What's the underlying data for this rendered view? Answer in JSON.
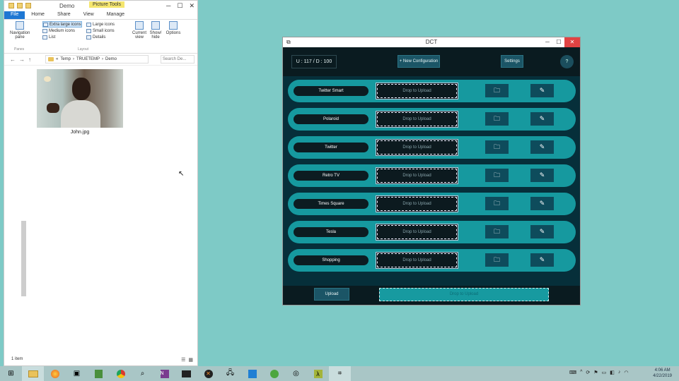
{
  "explorer": {
    "title": "Demo",
    "picture_tools": "Picture Tools",
    "tabs": [
      "File",
      "Home",
      "Share",
      "View",
      "Manage"
    ],
    "ribbon": {
      "nav_pane": "Navigation pane",
      "group_panes": "Panes",
      "layout": [
        "Extra large icons",
        "Large icons",
        "Medium icons",
        "Small icons",
        "List",
        "Details"
      ],
      "group_layout": "Layout",
      "current_view": "Current view",
      "show_hide": "Show/ hide",
      "options": "Options"
    },
    "path": [
      "«",
      "Temp",
      "›",
      "TRUETEMP",
      "›",
      "Demo"
    ],
    "search_placeholder": "Search De...",
    "file_name": "John.jpg",
    "status": "1 item"
  },
  "dct": {
    "title": "DCT",
    "ud": "U : 117 / D : 100",
    "new_config": "+ New Configuration",
    "settings": "Settings",
    "help": "?",
    "drop_label": "Drop to Upload",
    "rows": [
      {
        "name": "Twitter Smart"
      },
      {
        "name": "Polaroid"
      },
      {
        "name": "Twitter"
      },
      {
        "name": "Retro TV"
      },
      {
        "name": "Times Square"
      },
      {
        "name": "Tesla"
      },
      {
        "name": "Shopping"
      }
    ],
    "upload": "Upload",
    "bottom_drop": "Drop to Upload"
  },
  "taskbar": {
    "icons": [
      "start-icon",
      "file-explorer-icon",
      "firefox-icon",
      "app-icon",
      "sheet-icon",
      "chrome-icon",
      "search-app-icon",
      "onenote-icon",
      "terminal-icon",
      "x-app-icon",
      "network-icon",
      "vscode-icon",
      "green-app-icon",
      "disk-icon",
      "lambda-icon",
      "crop-icon"
    ],
    "clock_time": "4:06 AM",
    "clock_date": "4/22/2019"
  },
  "colors": {
    "desktop": "#7ecac6",
    "row": "#16999f",
    "dark": "#0b1f24",
    "button": "#1b5566"
  }
}
